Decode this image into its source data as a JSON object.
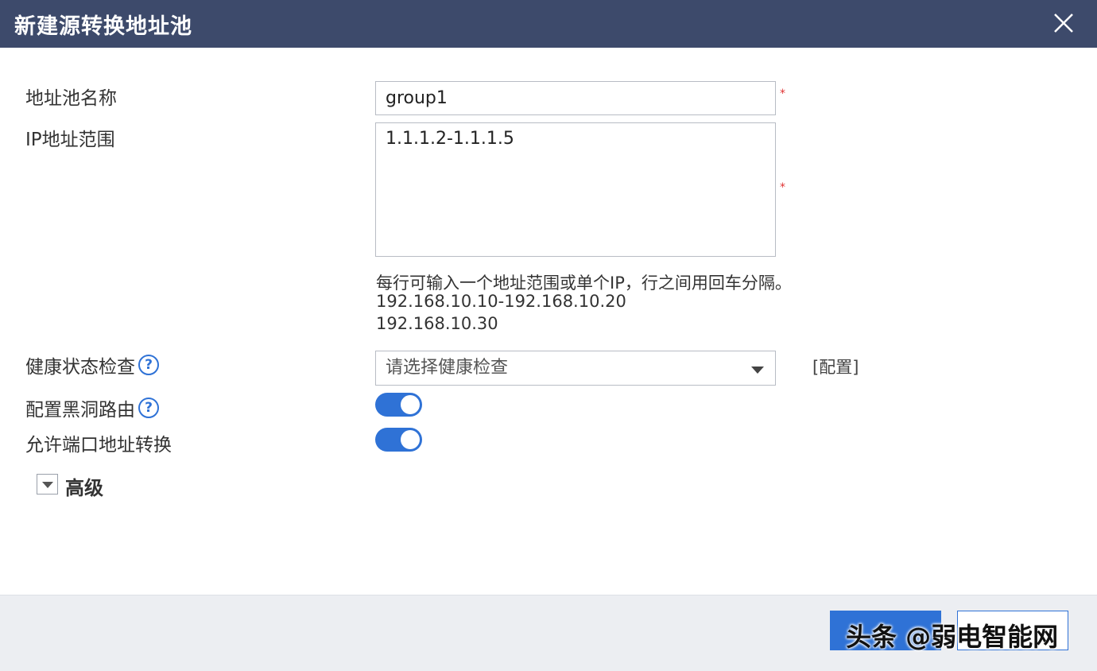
{
  "dialog": {
    "title": "新建源转换地址池",
    "close_icon": "close-icon"
  },
  "form": {
    "pool_name": {
      "label": "地址池名称",
      "value": "group1",
      "required_mark": "*"
    },
    "ip_range": {
      "label": "IP地址范围",
      "value": "1.1.1.2-1.1.1.5",
      "required_mark": "*",
      "hint_line1": "每行可输入一个地址范围或单个IP，行之间用回车分隔。",
      "hint_line2": "192.168.10.10-192.168.10.20",
      "hint_line3": "192.168.10.30"
    },
    "health_check": {
      "label": "健康状态检查",
      "help": "?",
      "placeholder": "请选择健康检查",
      "config_link": "[配置]"
    },
    "blackhole_route": {
      "label": "配置黑洞路由",
      "help": "?",
      "enabled": true
    },
    "port_translation": {
      "label": "允许端口地址转换",
      "enabled": true
    },
    "advanced": {
      "label": "高级",
      "expand_icon": "caret-down-icon"
    }
  },
  "footer": {
    "watermark": "头条 @弱电智能网"
  },
  "colors": {
    "titlebar": "#3d4a6b",
    "accent": "#2f72d6",
    "required": "#e03333",
    "footer_bg": "#eceef2"
  }
}
